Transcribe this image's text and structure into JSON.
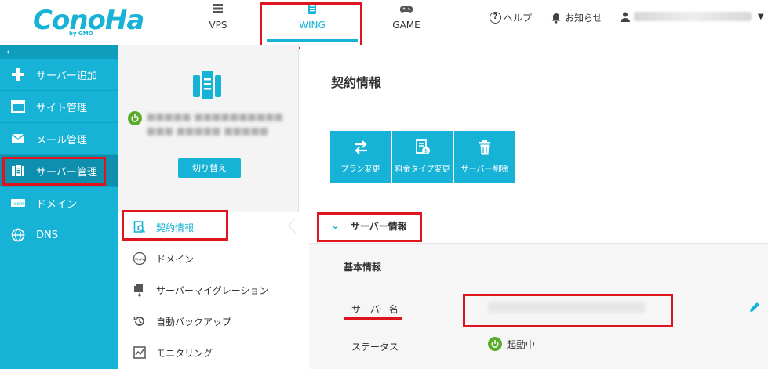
{
  "brand": {
    "logo_text": "ConoHa",
    "logo_sub": "by GMO",
    "accent": "#17b3d6",
    "highlight": "#e0141e"
  },
  "topnav": {
    "tabs": [
      {
        "label": "VPS",
        "icon": "server-stack-icon"
      },
      {
        "label": "WING",
        "icon": "wing-server-icon",
        "active": true
      },
      {
        "label": "GAME",
        "icon": "gamepad-icon"
      }
    ],
    "help_label": "ヘルプ",
    "notice_label": "お知らせ"
  },
  "sidebar": {
    "items": [
      {
        "label": "サーバー追加",
        "icon": "plus-icon"
      },
      {
        "label": "サイト管理",
        "icon": "window-icon"
      },
      {
        "label": "メール管理",
        "icon": "mail-icon"
      },
      {
        "label": "サーバー管理",
        "icon": "server-icon",
        "active": true
      },
      {
        "label": "ドメイン",
        "icon": "domain-icon"
      },
      {
        "label": "DNS",
        "icon": "globe-icon"
      }
    ]
  },
  "server_panel": {
    "switch_label": "切り替え"
  },
  "submenu": {
    "items": [
      {
        "label": "契約情報",
        "icon": "contract-search-icon",
        "active": true
      },
      {
        "label": "ドメイン",
        "icon": "www-icon"
      },
      {
        "label": "サーバーマイグレーション",
        "icon": "migration-icon"
      },
      {
        "label": "自動バックアップ",
        "icon": "backup-icon"
      },
      {
        "label": "モニタリング",
        "icon": "monitoring-icon"
      }
    ]
  },
  "main": {
    "title": "契約情報",
    "actions": [
      {
        "label": "プラン変更",
        "icon": "swap-icon"
      },
      {
        "label": "料金タイプ変更",
        "icon": "billing-icon"
      },
      {
        "label": "サーバー削除",
        "icon": "trash-icon"
      }
    ],
    "section_title": "サーバー情報",
    "basic_info_label": "基本情報",
    "server_name_label": "サーバー名",
    "status_label": "ステータス",
    "status_value": "起動中"
  }
}
